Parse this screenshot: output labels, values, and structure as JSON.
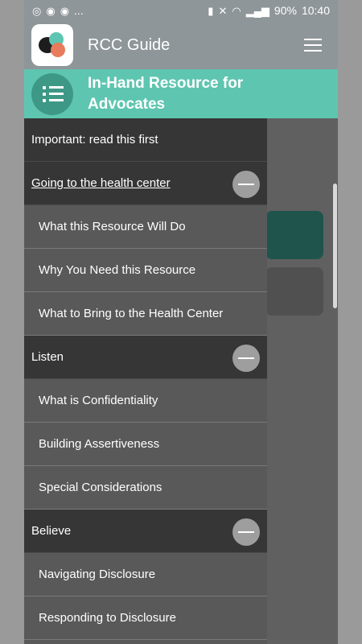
{
  "status_bar": {
    "left_icons": [
      "whatsapp-icon",
      "podcast-icon",
      "podcast-icon",
      "more-dots"
    ],
    "more": "...",
    "battery": "90%",
    "time": "10:40"
  },
  "app_bar": {
    "title": "RCC Guide"
  },
  "banner": {
    "title_line1": "In-Hand Resource for",
    "title_line2": "Advocates"
  },
  "menu": {
    "items": [
      {
        "label": "Important: read this first",
        "type": "header"
      },
      {
        "label": "Going to the health center",
        "type": "header"
      },
      {
        "label": "What this Resource Will Do",
        "type": "sub"
      },
      {
        "label": "Why You Need this Resource",
        "type": "sub"
      },
      {
        "label": "What to Bring to the Health Center",
        "type": "sub"
      },
      {
        "label": "Listen",
        "type": "header"
      },
      {
        "label": "What is Confidentiality",
        "type": "sub"
      },
      {
        "label": "Building Assertiveness",
        "type": "sub"
      },
      {
        "label": "Special Considerations",
        "type": "sub"
      },
      {
        "label": "Believe",
        "type": "header"
      },
      {
        "label": "Navigating Disclosure",
        "type": "sub"
      },
      {
        "label": "Responding to Disclosure",
        "type": "sub"
      }
    ]
  },
  "colors": {
    "accent": "#5ec5b0",
    "header_bg": "#363636",
    "sub_bg": "#595959"
  }
}
